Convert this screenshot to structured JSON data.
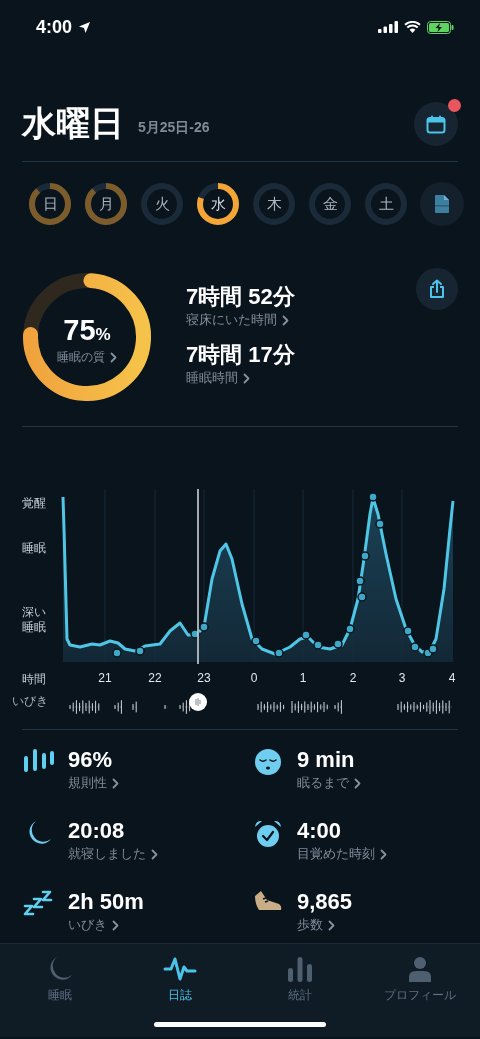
{
  "status_bar": {
    "time": "4:00"
  },
  "header": {
    "title": "水曜日",
    "date_range": "5月25日-26",
    "calendar_badge": true
  },
  "days": [
    {
      "label": "日",
      "recorded": true,
      "selected": false
    },
    {
      "label": "月",
      "recorded": true,
      "selected": false
    },
    {
      "label": "火",
      "recorded": false,
      "selected": false
    },
    {
      "label": "水",
      "recorded": true,
      "selected": true
    },
    {
      "label": "木",
      "recorded": false,
      "selected": false
    },
    {
      "label": "金",
      "recorded": false,
      "selected": false
    },
    {
      "label": "土",
      "recorded": false,
      "selected": false
    }
  ],
  "summary": {
    "quality": {
      "value": "75",
      "unit": "%",
      "label": "睡眠の質"
    },
    "metrics": [
      {
        "value": "7時間 52分",
        "label": "寝床にいた時間"
      },
      {
        "value": "7時間 17分",
        "label": "睡眠時間"
      }
    ]
  },
  "sleep_graph": {
    "y_labels": [
      "覚醒",
      "睡眠",
      "深い睡眠"
    ],
    "x_axis_label": "時間",
    "x_ticks": [
      "21",
      "22",
      "23",
      "0",
      "1",
      "2",
      "3",
      "4"
    ],
    "snore_label": "いびき"
  },
  "stats": [
    {
      "kind": "regularity",
      "value": "96%",
      "label": "規則性"
    },
    {
      "kind": "latency",
      "value": "9 min",
      "label": "眠るまで"
    },
    {
      "kind": "bedtime",
      "value": "20:08",
      "label": "就寝しました"
    },
    {
      "kind": "wakeup",
      "value": "4:00",
      "label": "目覚めた時刻"
    },
    {
      "kind": "snore",
      "value": "2h 50m",
      "label": "いびき"
    },
    {
      "kind": "steps",
      "value": "9,865",
      "label": "歩数"
    }
  ],
  "tab_bar": [
    {
      "kind": "sleep",
      "label": "睡眠",
      "selected": false
    },
    {
      "kind": "journal",
      "label": "日誌",
      "selected": true
    },
    {
      "kind": "stats",
      "label": "統計",
      "selected": false
    },
    {
      "kind": "profile",
      "label": "プロフィール",
      "selected": false
    }
  ]
}
